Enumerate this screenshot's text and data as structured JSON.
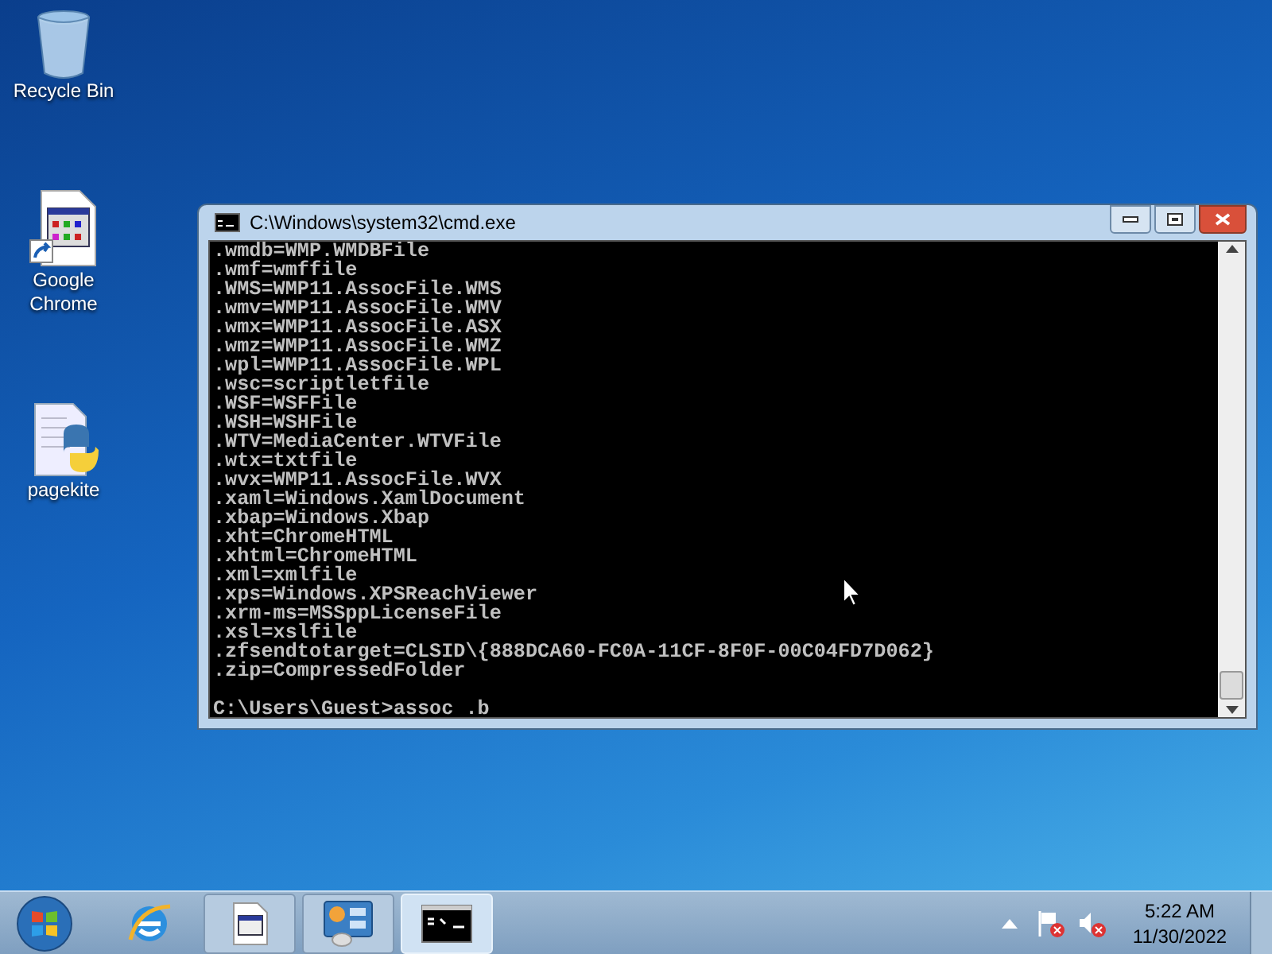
{
  "desktop_icons": [
    {
      "label": "Recycle Bin",
      "kind": "bin"
    },
    {
      "label": "Google Chrome",
      "kind": "shortcut"
    },
    {
      "label": "pagekite",
      "kind": "python"
    }
  ],
  "window": {
    "title": "C:\\Windows\\system32\\cmd.exe",
    "lines": [
      ".wmdb=WMP.WMDBFile",
      ".wmf=wmffile",
      ".WMS=WMP11.AssocFile.WMS",
      ".wmv=WMP11.AssocFile.WMV",
      ".wmx=WMP11.AssocFile.ASX",
      ".wmz=WMP11.AssocFile.WMZ",
      ".wpl=WMP11.AssocFile.WPL",
      ".wsc=scriptletfile",
      ".WSF=WSFFile",
      ".WSH=WSHFile",
      ".WTV=MediaCenter.WTVFile",
      ".wtx=txtfile",
      ".wvx=WMP11.AssocFile.WVX",
      ".xaml=Windows.XamlDocument",
      ".xbap=Windows.Xbap",
      ".xht=ChromeHTML",
      ".xhtml=ChromeHTML",
      ".xml=xmlfile",
      ".xps=Windows.XPSReachViewer",
      ".xrm-ms=MSSppLicenseFile",
      ".xsl=xslfile",
      ".zfsendtotarget=CLSID\\{888DCA60-FC0A-11CF-8F0F-00C04FD7D062}",
      ".zip=CompressedFolder"
    ],
    "prompt": "C:\\Users\\Guest>assoc .b"
  },
  "taskbar": {
    "buttons": [
      {
        "kind": "document",
        "selected": false
      },
      {
        "kind": "control-panel",
        "selected": false
      },
      {
        "kind": "console",
        "selected": true
      }
    ],
    "time": "5:22 AM",
    "date": "11/30/2022"
  }
}
